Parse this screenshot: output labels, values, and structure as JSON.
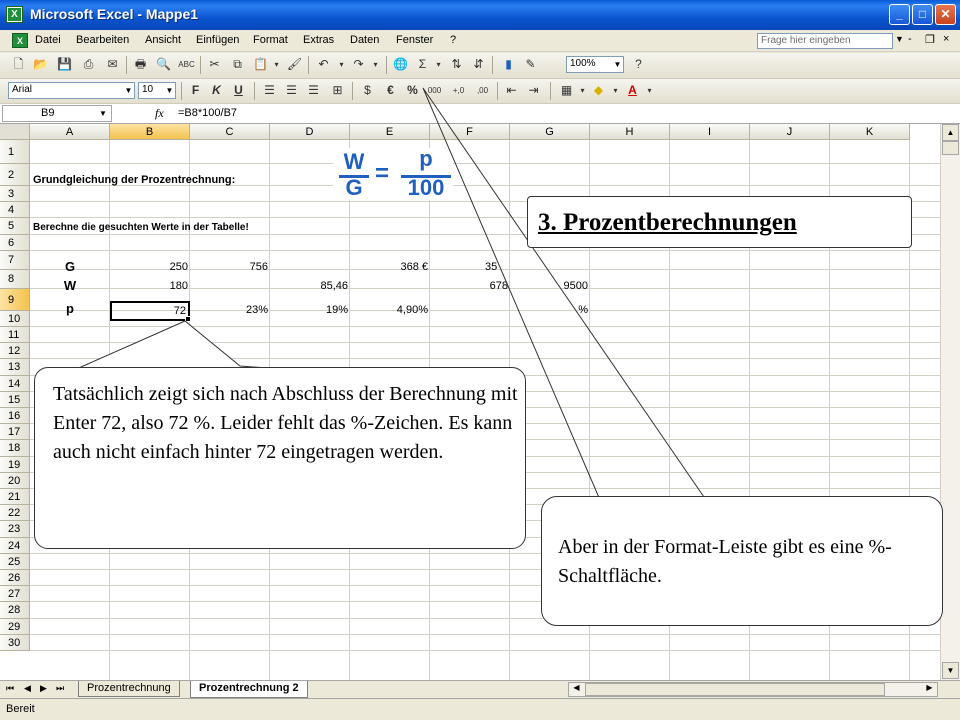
{
  "window": {
    "title": "Microsoft Excel - Mappe1"
  },
  "menu": [
    "Datei",
    "Bearbeiten",
    "Ansicht",
    "Einfügen",
    "Format",
    "Extras",
    "Daten",
    "Fenster",
    "?"
  ],
  "help_placeholder": "Frage hier eingeben",
  "toolbar": {
    "zoom": "100%",
    "font_name": "Arial",
    "font_size": "10",
    "bold": "F",
    "italic": "K",
    "underline": "U",
    "currency": "€",
    "percent": "%",
    "thousands": "000"
  },
  "formula_bar": {
    "name_box": "B9",
    "fx": "fx",
    "formula": "=B8*100/B7"
  },
  "columns": [
    "A",
    "B",
    "C",
    "D",
    "E",
    "F",
    "G",
    "H",
    "I",
    "J",
    "K"
  ],
  "rows": [
    "1",
    "2",
    "3",
    "4",
    "5",
    "6",
    "7",
    "8",
    "9",
    "10",
    "11",
    "12",
    "13",
    "14",
    "15",
    "16",
    "17",
    "18",
    "19",
    "20",
    "21",
    "22",
    "23",
    "24",
    "25",
    "26",
    "27",
    "28",
    "29",
    "30"
  ],
  "cells": {
    "A2": "Grundgleichung der Prozentrechnung:",
    "A5": "Berechne die gesuchten Werte in der Tabelle!",
    "A7": "G",
    "B7": "250",
    "C7": "756",
    "E7": "368 €",
    "F7": "35",
    "A8": "W",
    "B8": "180",
    "D8": "85,46",
    "F8": "678",
    "G8": "9500",
    "A9": "p",
    "B9": "72",
    "C9": "23%",
    "D9": "19%",
    "E9": "4,90%",
    "G9": "%"
  },
  "formula_image": {
    "w": "W",
    "g": "G",
    "p": "p",
    "hundred": "100",
    "equals": "="
  },
  "sheet_tabs": {
    "tab1": "Prozentrechnung",
    "tab2": "Prozentrechnung 2"
  },
  "status": "Bereit",
  "title_box": "3. Prozentberechnungen",
  "callout_left": "Tatsächlich zeigt sich nach Abschluss der Berechnung mit Enter 72, also 72 %. Leider fehlt das %-Zeichen. Es kann auch nicht einfach hinter 72 eingetragen werden.",
  "callout_right": "Aber in der Format-Leiste gibt es eine %-Schaltfläche.",
  "colors": {
    "title_bar": "#0a5bd6",
    "formula_blue": "#1f5fbf",
    "selected_header": "#f5c24e"
  }
}
